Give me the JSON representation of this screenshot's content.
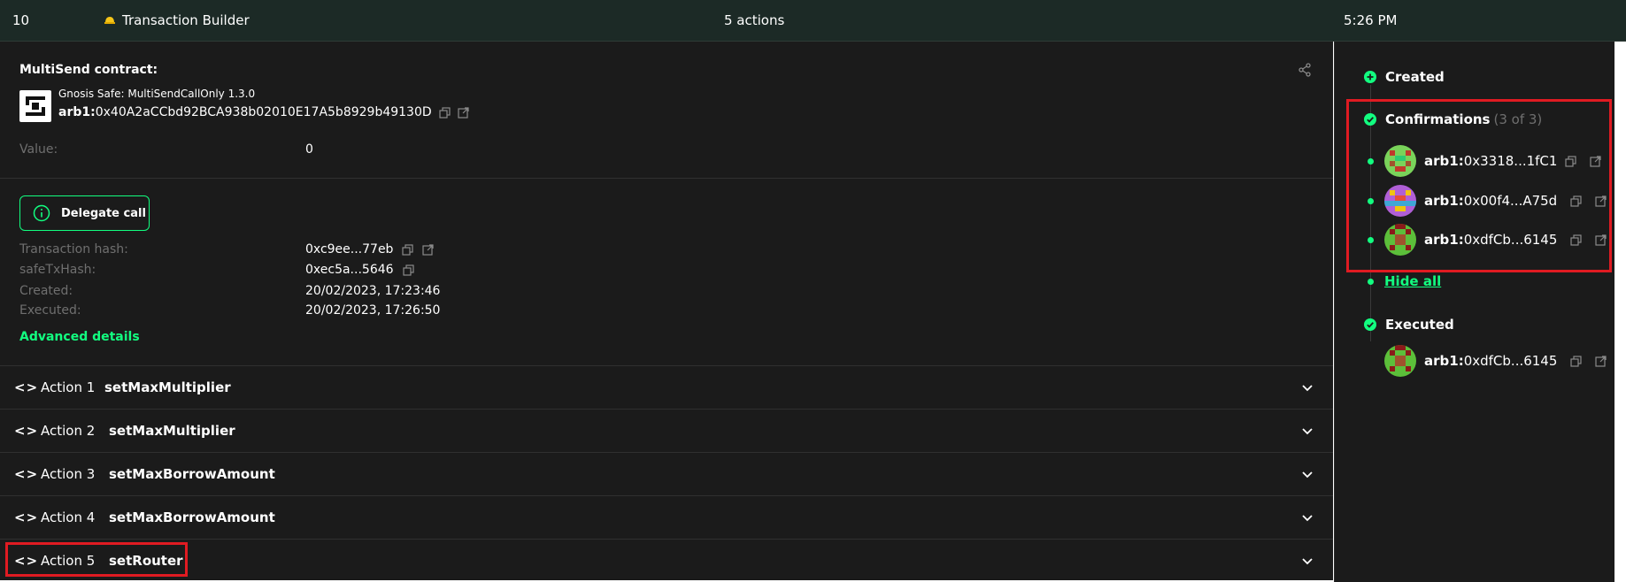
{
  "topbar": {
    "nonce": "10",
    "app_name": "Transaction Builder",
    "actions_count": "5 actions",
    "time": "5:26 PM"
  },
  "contract": {
    "title": "MultiSend contract:",
    "name": "Gnosis Safe: MultiSendCallOnly 1.3.0",
    "prefix": "arb1:",
    "address": "0x40A2aCCbd92BCA938b02010E17A5b8929b49130D"
  },
  "value": {
    "label": "Value:",
    "amount": "0"
  },
  "delegate_label": "Delegate call",
  "details": [
    {
      "label": "Transaction hash:",
      "value": "0xc9ee...77eb"
    },
    {
      "label": "safeTxHash:",
      "value": "0xec5a...5646"
    },
    {
      "label": "Created:",
      "value": "20/02/2023, 17:23:46"
    },
    {
      "label": "Executed:",
      "value": "20/02/2023, 17:26:50"
    }
  ],
  "advanced_details": "Advanced details",
  "actions": [
    {
      "code": "<>",
      "label": "Action 1",
      "method": "setMaxMultiplier"
    },
    {
      "code": "<>",
      "label": "Action 2",
      "method": "setMaxMultiplier"
    },
    {
      "code": "<>",
      "label": "Action 3",
      "method": "setMaxBorrowAmount"
    },
    {
      "code": "<>",
      "label": "Action 4",
      "method": "setMaxBorrowAmount"
    },
    {
      "code": "<>",
      "label": "Action 5",
      "method": "setRouter"
    }
  ],
  "sidebar": {
    "created": "Created",
    "confirmations": "Confirmations",
    "confirmations_count": "(3 of 3)",
    "signers": [
      {
        "prefix": "arb1:",
        "address": "0x3318...1fC1"
      },
      {
        "prefix": "arb1:",
        "address": "0x00f4...A75d"
      },
      {
        "prefix": "arb1:",
        "address": "0xdfCb...6145"
      }
    ],
    "hide_all": "Hide all",
    "executed": "Executed",
    "executor": {
      "prefix": "arb1:",
      "address": "0xdfCb...6145"
    }
  },
  "colors": {
    "accent": "#12ff80",
    "highlight": "#e01b22",
    "background": "#1b1b1b",
    "topbar": "#1c2a26"
  }
}
